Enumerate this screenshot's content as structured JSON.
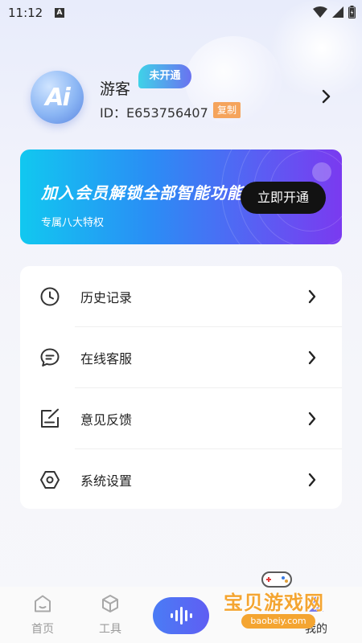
{
  "status_bar": {
    "time": "11:12",
    "notif_letter": "A"
  },
  "profile": {
    "avatar_text": "Ai",
    "username": "游客",
    "vip_status": "未开通",
    "id_text": "ID：E653756407",
    "copy_label": "复制"
  },
  "banner": {
    "title": "加入会员解锁全部智能功能",
    "subtitle": "专属八大特权",
    "button_label": "立即开通"
  },
  "menu": {
    "items": [
      {
        "label": "历史记录",
        "icon": "clock-icon"
      },
      {
        "label": "在线客服",
        "icon": "chat-bubble-icon"
      },
      {
        "label": "意见反馈",
        "icon": "edit-note-icon"
      },
      {
        "label": "系统设置",
        "icon": "hexagon-settings-icon"
      }
    ]
  },
  "bottom_nav": {
    "items": [
      {
        "label": "首页",
        "icon": "home-icon"
      },
      {
        "label": "工具",
        "icon": "cube-icon"
      },
      {
        "label": "",
        "icon": "voice-wave-icon"
      },
      {
        "label": "我的",
        "icon": "profile-icon"
      }
    ]
  },
  "watermark": {
    "text": "宝贝游戏网",
    "url": "baobeiy.com"
  },
  "colors": {
    "vip_badge": "#5d7af0",
    "copy_badge": "#f5a45c",
    "banner_start": "#11c8f0",
    "banner_end": "#7a3af0",
    "voice_button": "#5a6cf4",
    "watermark": "#f4a531"
  }
}
